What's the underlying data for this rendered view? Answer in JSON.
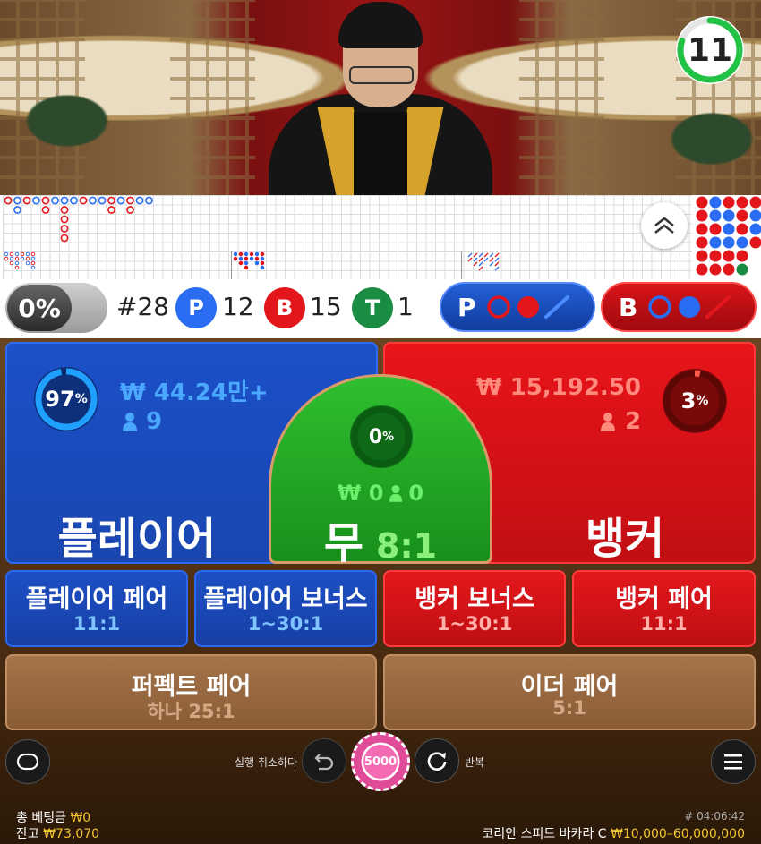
{
  "timer": {
    "value": "11",
    "fraction_remaining": 0.8,
    "ring_color": "#22c244"
  },
  "roads": {
    "big_road_label": "",
    "expand_icon": "chevron-up-icon"
  },
  "stats": {
    "percent": "0%",
    "round": "#28",
    "player_letter": "P",
    "player_count": "12",
    "banker_letter": "B",
    "banker_count": "15",
    "tie_letter": "T",
    "tie_count": "1",
    "player_ask": "P",
    "banker_ask": "B",
    "colors": {
      "player": "#2a6df2",
      "banker": "#e3161c",
      "tie": "#1a8c43"
    }
  },
  "player": {
    "percent": "97",
    "percent_sign": "%",
    "amount": "₩ 44.24만+",
    "users": "9",
    "label": "플레이어"
  },
  "banker": {
    "percent": "3",
    "percent_sign": "%",
    "amount": "₩ 15,192.50",
    "users": "2",
    "label": "뱅커"
  },
  "tie": {
    "percent": "0",
    "percent_sign": "%",
    "amount": "₩ 0",
    "users": "0",
    "label": "무",
    "odds": "8:1"
  },
  "side_bets": [
    {
      "title": "플레이어 페어",
      "odds": "11:1"
    },
    {
      "title": "플레이어 보너스",
      "odds": "1~30:1"
    },
    {
      "title": "뱅커 보너스",
      "odds": "1~30:1"
    },
    {
      "title": "뱅커 페어",
      "odds": "11:1"
    }
  ],
  "pair_bets": [
    {
      "title": "퍼펙트 페어",
      "odds": "하나 25:1"
    },
    {
      "title": "이더 페어",
      "odds": "5:1"
    }
  ],
  "controls": {
    "undo_label": "실행 취소하다",
    "chip_value": "5000",
    "repeat_label": "반복"
  },
  "footer": {
    "total_bet_label": "총 베팅금",
    "total_bet_value": "₩0",
    "balance_label": "잔고",
    "balance_value": "₩73,070",
    "game_id": "# 04:06:42",
    "table_name": "코리안 스피드 바카라 C",
    "limits": "₩10,000–60,000,000"
  }
}
